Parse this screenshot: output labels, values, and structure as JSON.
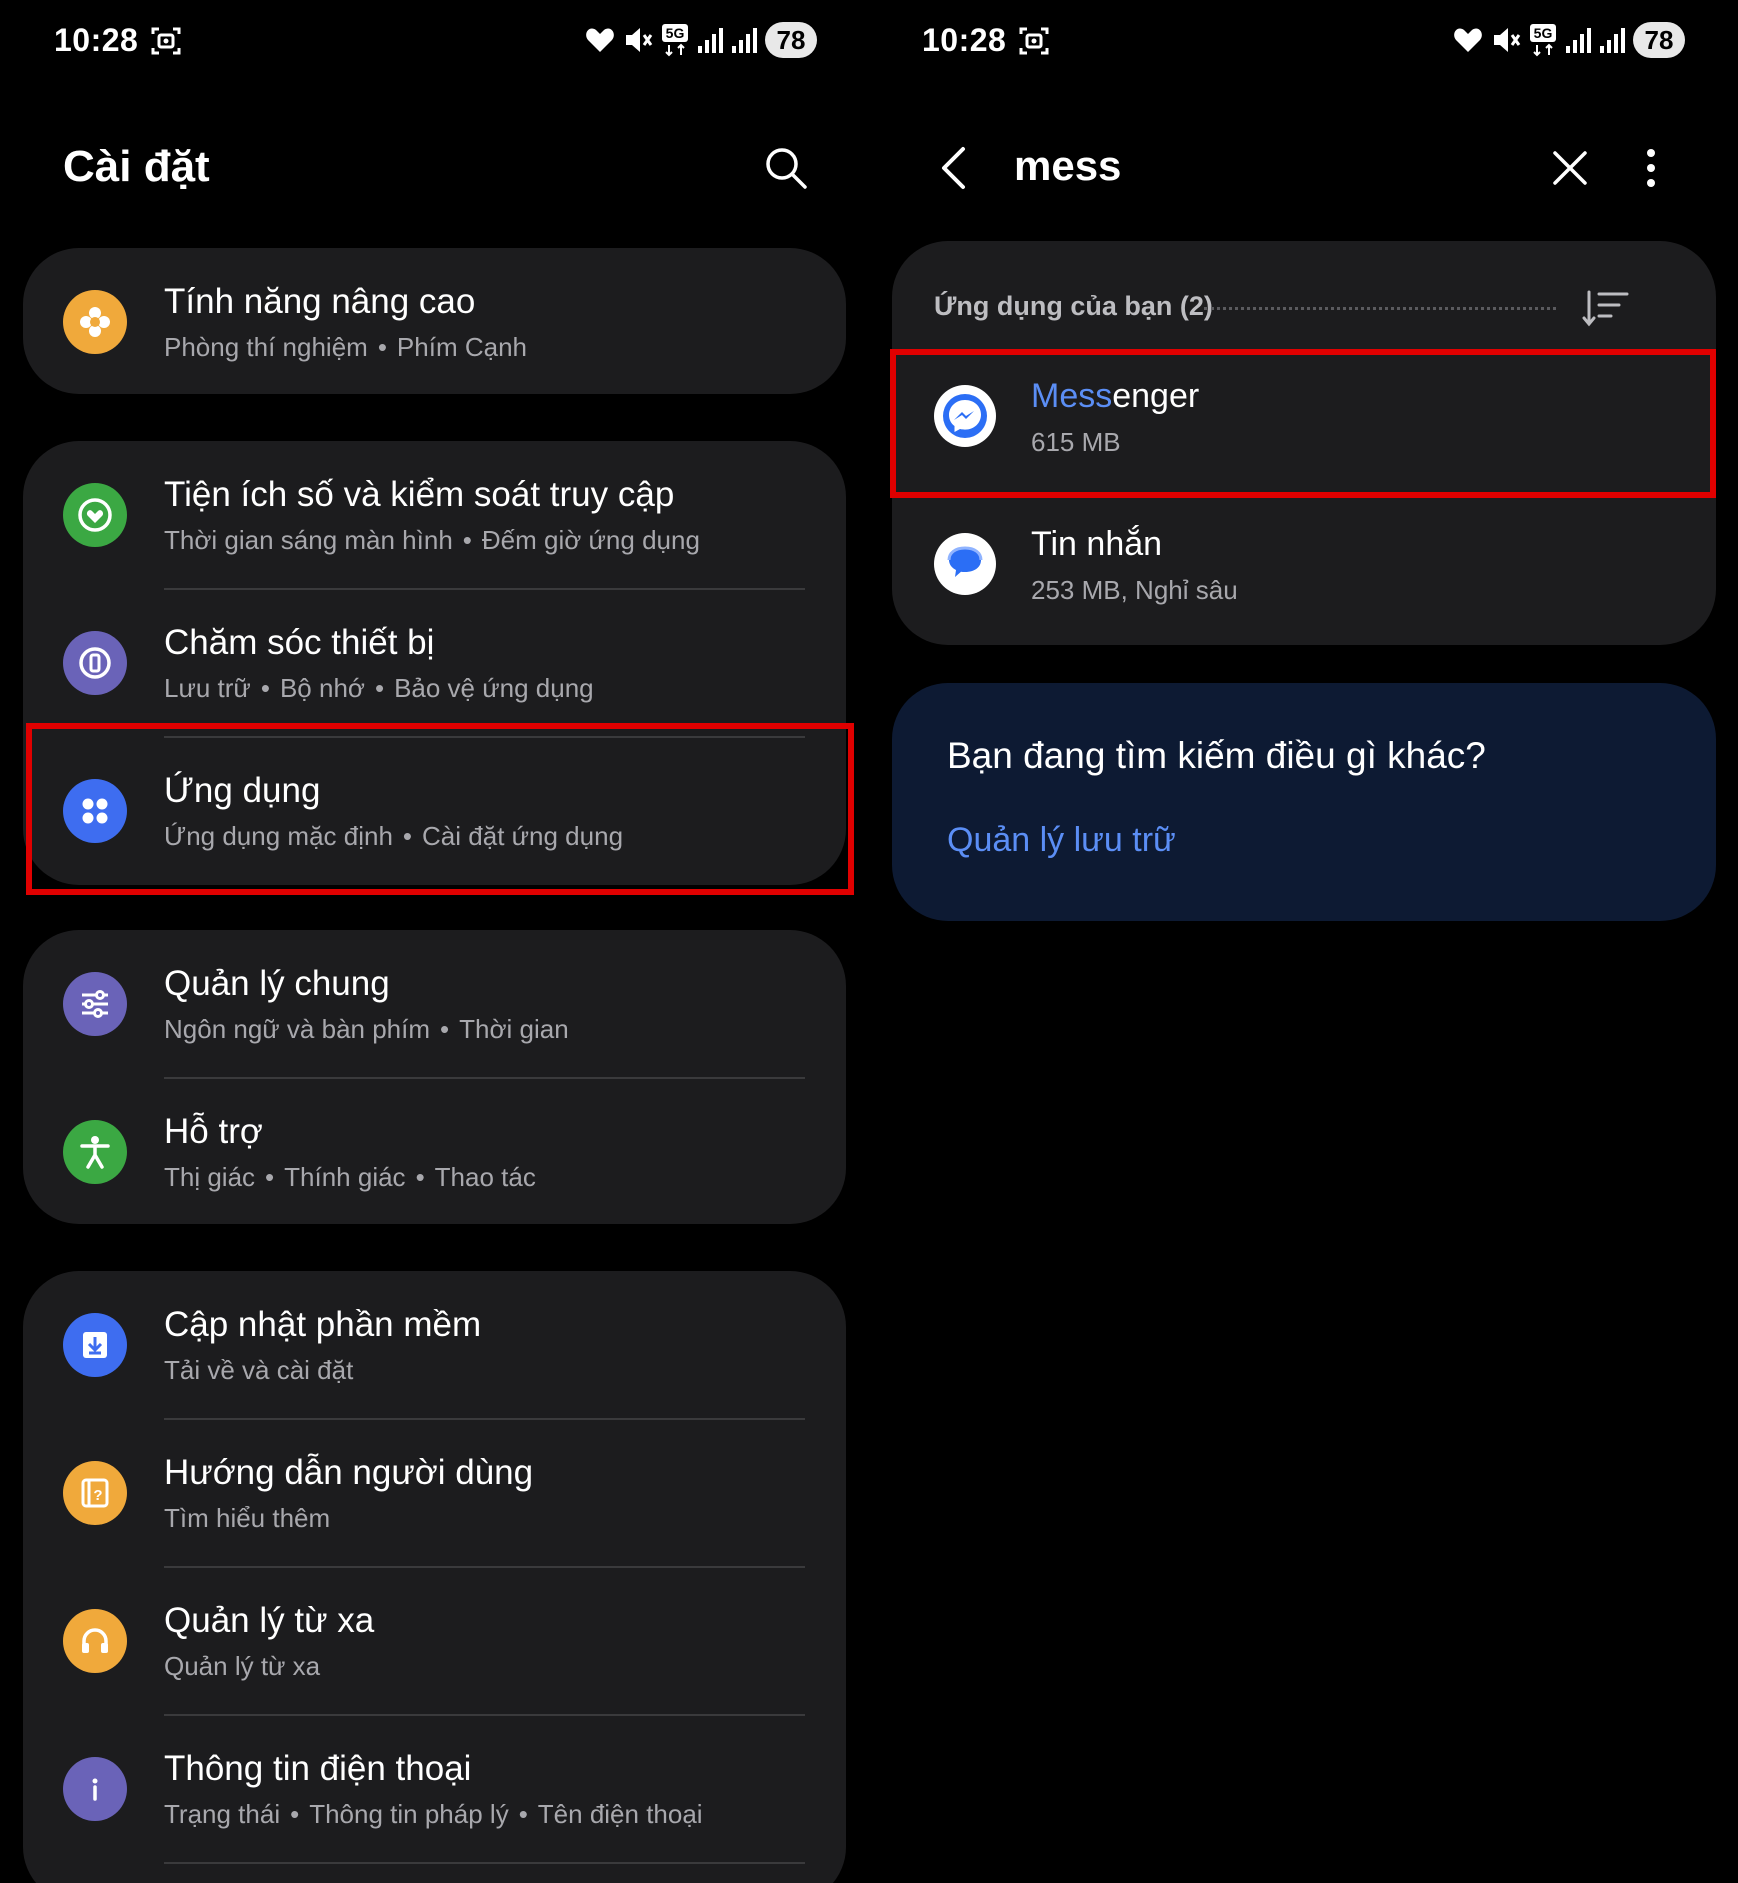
{
  "status_bar": {
    "time": "10:28",
    "network": "5G",
    "battery": "78",
    "icons": [
      "screen-record-icon",
      "heart-icon",
      "mute-icon",
      "5g-icon",
      "signal-icon",
      "signal-icon",
      "battery-icon"
    ]
  },
  "settings": {
    "title": "Cài đặt",
    "search_icon": "search-icon",
    "groups": [
      {
        "items": [
          {
            "name": "advanced-features",
            "title": "Tính năng nâng cao",
            "subs": [
              "Phòng thí nghiệm",
              "Phím Cạnh"
            ],
            "icon": "flower-gear-icon",
            "color": "#f0a93b"
          }
        ]
      },
      {
        "items": [
          {
            "name": "digital-wellbeing",
            "title": "Tiện ích số và kiểm soát truy cập",
            "subs": [
              "Thời gian sáng màn hình",
              "Đếm giờ ứng dụng"
            ],
            "icon": "wellbeing-heart-icon",
            "color": "#3ba843"
          },
          {
            "name": "device-care",
            "title": "Chăm sóc thiết bị",
            "subs": [
              "Lưu trữ",
              "Bộ nhớ",
              "Bảo vệ ứng dụng"
            ],
            "icon": "device-care-icon",
            "color": "#6a63b8"
          },
          {
            "name": "apps",
            "title": "Ứng dụng",
            "subs": [
              "Ứng dụng mặc định",
              "Cài đặt ứng dụng"
            ],
            "icon": "apps-grid-icon",
            "color": "#3e6df0"
          }
        ]
      },
      {
        "items": [
          {
            "name": "general-management",
            "title": "Quản lý chung",
            "subs": [
              "Ngôn ngữ và bàn phím",
              "Thời gian"
            ],
            "icon": "sliders-icon",
            "color": "#6a63b8"
          },
          {
            "name": "accessibility",
            "title": "Hỗ trợ",
            "subs": [
              "Thị giác",
              "Thính giác",
              "Thao tác"
            ],
            "icon": "accessibility-icon",
            "color": "#3ba843"
          }
        ]
      },
      {
        "items": [
          {
            "name": "software-update",
            "title": "Cập nhật phần mềm",
            "subs": [
              "Tải về và cài đặt"
            ],
            "icon": "download-icon",
            "color": "#3e6df0"
          },
          {
            "name": "user-guide",
            "title": "Hướng dẫn người dùng",
            "subs": [
              "Tìm hiểu thêm"
            ],
            "icon": "guide-book-icon",
            "color": "#f0a93b"
          },
          {
            "name": "remote-support",
            "title": "Quản lý từ xa",
            "subs": [
              "Quản lý từ xa"
            ],
            "icon": "headset-icon",
            "color": "#f0a93b"
          },
          {
            "name": "about-phone",
            "title": "Thông tin điện thoại",
            "subs": [
              "Trạng thái",
              "Thông tin pháp lý",
              "Tên điện thoại"
            ],
            "icon": "info-icon",
            "color": "#6a63b8"
          }
        ]
      }
    ]
  },
  "search": {
    "query": "mess",
    "section_title": "Ứng dụng của bạn (2)",
    "results": [
      {
        "name_match": "Mess",
        "name_rest": "enger",
        "sub": "615 MB",
        "icon": "messenger-icon"
      },
      {
        "name_match": "",
        "name_rest": "Tin nhắn",
        "sub": "253 MB, Nghỉ sâu",
        "icon": "messages-icon"
      }
    ],
    "more_question": "Bạn đang tìm kiếm điều gì khác?",
    "more_link": "Quản lý lưu trữ"
  },
  "colors": {
    "highlight": "#e00000",
    "accent": "#5b8ef5"
  }
}
